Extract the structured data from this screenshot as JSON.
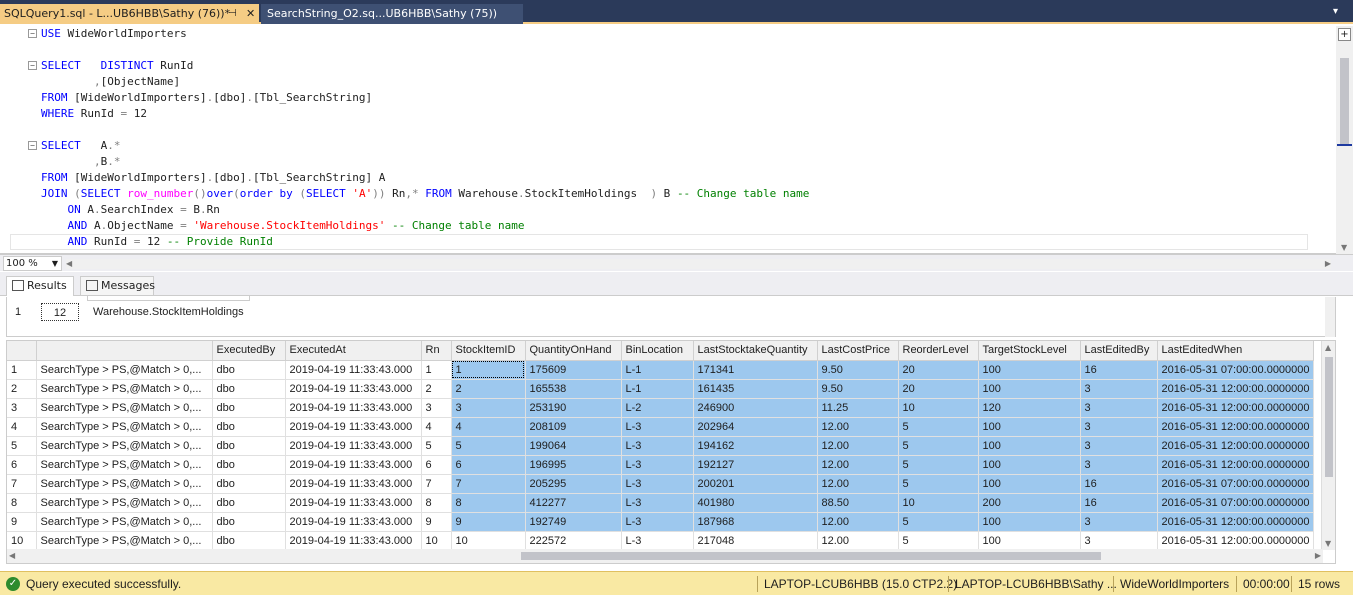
{
  "tabs": [
    {
      "label": "SQLQuery1.sql - L...UB6HBB\\Sathy (76))*",
      "pin": "⊣",
      "close": "✕",
      "active": true
    },
    {
      "label": "SearchString_O2.sq...UB6HBB\\Sathy (75))",
      "active": false
    }
  ],
  "editor": {
    "lines": [
      {
        "text": "USE WideWorldImporters",
        "fold": "−"
      },
      {
        "text": "",
        "fold": ""
      },
      {
        "text": "SELECT   DISTINCT RunId",
        "fold": "−"
      },
      {
        "text": "        ,[ObjectName]",
        "fold": ""
      },
      {
        "text": "FROM [WideWorldImporters].[dbo].[Tbl_SearchString]",
        "fold": ""
      },
      {
        "text": "WHERE RunId = 12",
        "fold": ""
      },
      {
        "text": "",
        "fold": ""
      },
      {
        "text": "SELECT   A.*",
        "fold": "−"
      },
      {
        "text": "        ,B.*",
        "fold": ""
      },
      {
        "text": "FROM [WideWorldImporters].[dbo].[Tbl_SearchString] A",
        "fold": ""
      },
      {
        "text": "JOIN (SELECT row_number()over(order by (SELECT 'A')) Rn,* FROM Warehouse.StockItemHoldings  ) B -- Change table name",
        "fold": ""
      },
      {
        "text": "    ON A.SearchIndex = B.Rn",
        "fold": ""
      },
      {
        "text": "    AND A.ObjectName = 'Warehouse.StockItemHoldings' -- Change table name",
        "fold": ""
      },
      {
        "text": "    AND RunId = 12 -- Provide RunId",
        "fold": ""
      }
    ]
  },
  "zoom": {
    "value": "100 %"
  },
  "result_tabs": {
    "results": "Results",
    "messages": "Messages"
  },
  "grid1": {
    "row_num": "1",
    "run_id": "12",
    "object_name": "Warehouse.StockItemHoldings"
  },
  "grid2": {
    "columns": [
      "",
      "",
      "ExecutedBy",
      "ExecutedAt",
      "Rn",
      "StockItemID",
      "QuantityOnHand",
      "BinLocation",
      "LastStocktakeQuantity",
      "LastCostPrice",
      "ReorderLevel",
      "TargetStockLevel",
      "LastEditedBy",
      "LastEditedWhen"
    ],
    "rows": [
      [
        "1",
        "SearchType > PS,@Match > 0,...",
        "dbo",
        "2019-04-19 11:33:43.000",
        "1",
        "1",
        "175609",
        "L-1",
        "171341",
        "9.50",
        "20",
        "100",
        "16",
        "2016-05-31 07:00:00.0000000"
      ],
      [
        "2",
        "SearchType > PS,@Match > 0,...",
        "dbo",
        "2019-04-19 11:33:43.000",
        "2",
        "2",
        "165538",
        "L-1",
        "161435",
        "9.50",
        "20",
        "100",
        "3",
        "2016-05-31 12:00:00.0000000"
      ],
      [
        "3",
        "SearchType > PS,@Match > 0,...",
        "dbo",
        "2019-04-19 11:33:43.000",
        "3",
        "3",
        "253190",
        "L-2",
        "246900",
        "11.25",
        "10",
        "120",
        "3",
        "2016-05-31 12:00:00.0000000"
      ],
      [
        "4",
        "SearchType > PS,@Match > 0,...",
        "dbo",
        "2019-04-19 11:33:43.000",
        "4",
        "4",
        "208109",
        "L-3",
        "202964",
        "12.00",
        "5",
        "100",
        "3",
        "2016-05-31 12:00:00.0000000"
      ],
      [
        "5",
        "SearchType > PS,@Match > 0,...",
        "dbo",
        "2019-04-19 11:33:43.000",
        "5",
        "5",
        "199064",
        "L-3",
        "194162",
        "12.00",
        "5",
        "100",
        "3",
        "2016-05-31 12:00:00.0000000"
      ],
      [
        "6",
        "SearchType > PS,@Match > 0,...",
        "dbo",
        "2019-04-19 11:33:43.000",
        "6",
        "6",
        "196995",
        "L-3",
        "192127",
        "12.00",
        "5",
        "100",
        "3",
        "2016-05-31 12:00:00.0000000"
      ],
      [
        "7",
        "SearchType > PS,@Match > 0,...",
        "dbo",
        "2019-04-19 11:33:43.000",
        "7",
        "7",
        "205295",
        "L-3",
        "200201",
        "12.00",
        "5",
        "100",
        "16",
        "2016-05-31 07:00:00.0000000"
      ],
      [
        "8",
        "SearchType > PS,@Match > 0,...",
        "dbo",
        "2019-04-19 11:33:43.000",
        "8",
        "8",
        "412277",
        "L-3",
        "401980",
        "88.50",
        "10",
        "200",
        "16",
        "2016-05-31 07:00:00.0000000"
      ],
      [
        "9",
        "SearchType > PS,@Match > 0,...",
        "dbo",
        "2019-04-19 11:33:43.000",
        "9",
        "9",
        "192749",
        "L-3",
        "187968",
        "12.00",
        "5",
        "100",
        "3",
        "2016-05-31 12:00:00.0000000"
      ],
      [
        "10",
        "SearchType > PS,@Match > 0,...",
        "dbo",
        "2019-04-19 11:33:43.000",
        "10",
        "10",
        "222572",
        "L-3",
        "217048",
        "12.00",
        "5",
        "100",
        "3",
        "2016-05-31 12:00:00.0000000"
      ]
    ],
    "selected_rows": 9
  },
  "status": {
    "message": "Query executed successfully.",
    "server": "LAPTOP-LCUB6HBB (15.0 CTP2.2)",
    "user": "LAPTOP-LCUB6HBB\\Sathy ...",
    "database": "WideWorldImporters",
    "elapsed": "00:00:00",
    "rows": "15 rows",
    "ok_icon": "check-circle-icon",
    "bar_color": "#f9e9a3"
  }
}
